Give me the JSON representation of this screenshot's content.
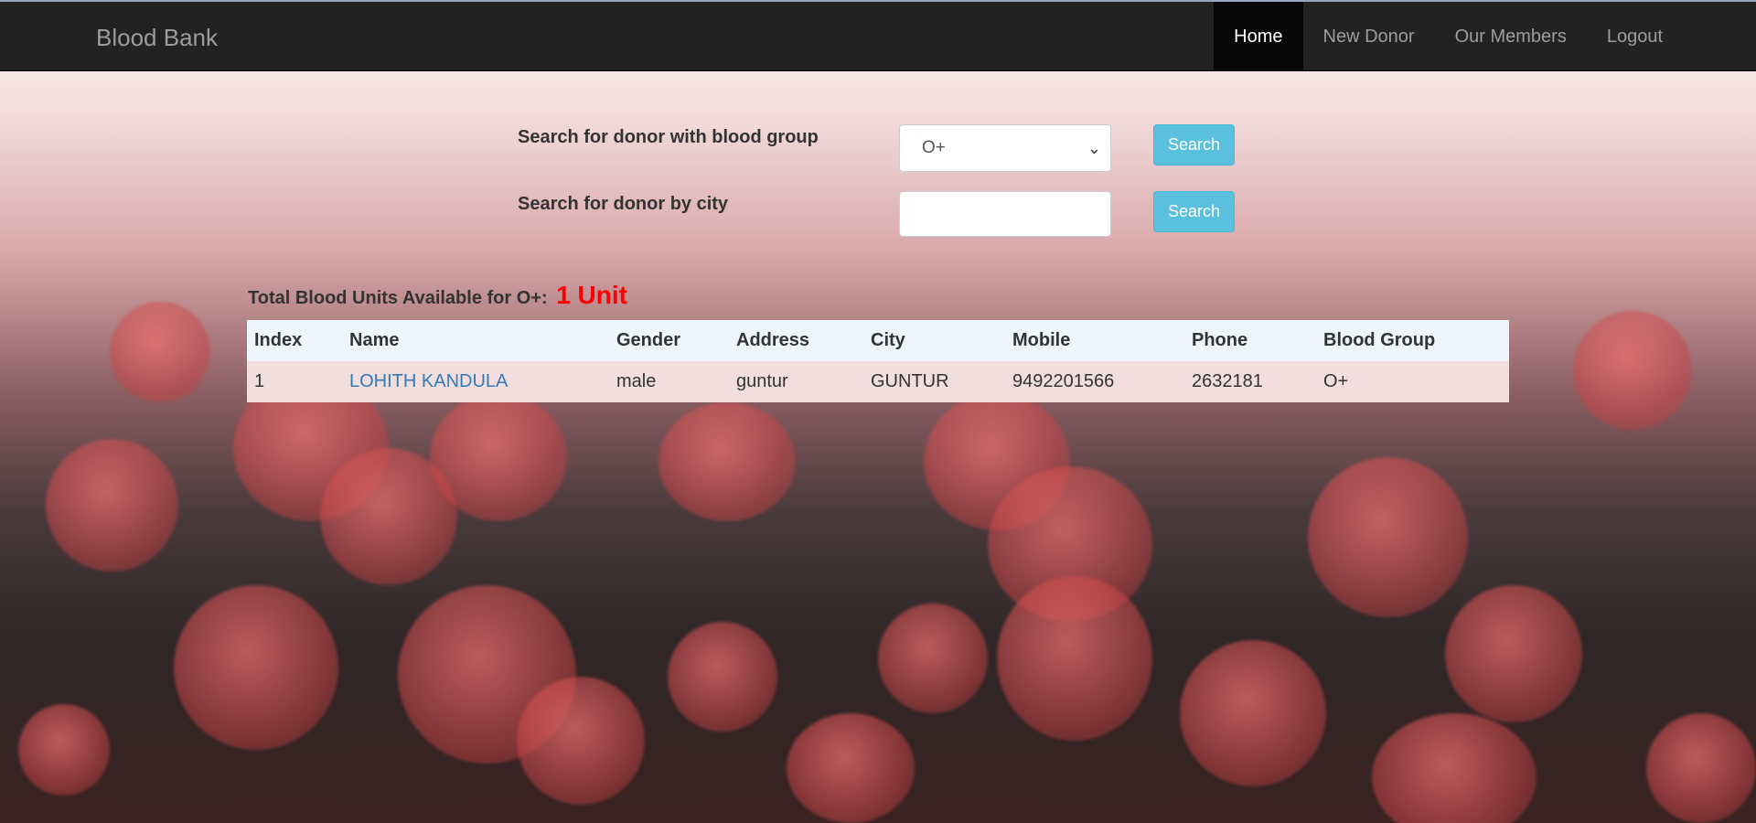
{
  "app": {
    "brand": "Blood Bank"
  },
  "nav": {
    "items": [
      {
        "label": "Home",
        "active": true
      },
      {
        "label": "New Donor"
      },
      {
        "label": "Our Members"
      },
      {
        "label": "Logout"
      }
    ]
  },
  "search": {
    "blood_group_label": "Search for donor with blood group",
    "blood_group_value": "O+",
    "city_label": "Search for donor by city",
    "city_value": "",
    "button_label": "Search"
  },
  "summary": {
    "label": "Total Blood Units Available for O+:",
    "units": "1 Unit",
    "units_color": "#ff0000"
  },
  "table": {
    "headers": [
      "Index",
      "Name",
      "Gender",
      "Address",
      "City",
      "Mobile",
      "Phone",
      "Blood Group"
    ],
    "rows": [
      [
        "1",
        "LOHITH KANDULA",
        "male",
        "guntur",
        "GUNTUR",
        "9492201566",
        "2632181",
        "O+"
      ]
    ]
  },
  "colors": {
    "navbar": "#222222",
    "button": "#5bc0de",
    "link": "#337ab7",
    "row_bg": "#f2dede",
    "header_bg": "#eef5fd"
  }
}
